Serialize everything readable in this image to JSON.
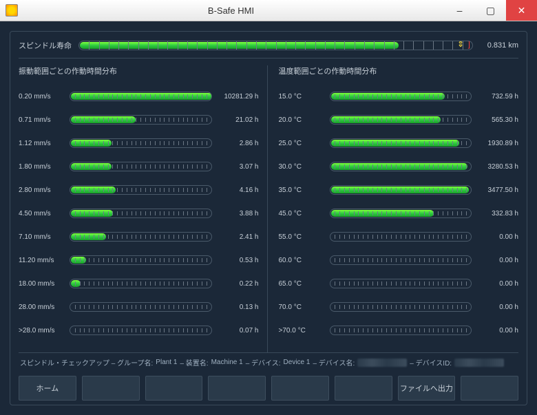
{
  "window": {
    "title": "B-Safe HMI"
  },
  "spindle": {
    "label": "スピンドル寿命",
    "value": "0.831 km",
    "fill_pct": 81
  },
  "left": {
    "title": "振動範囲ごとの作動時間分布",
    "rows": [
      {
        "label": "0.20 mm/s",
        "value": "10281.29 h",
        "pct": 100
      },
      {
        "label": "0.71 mm/s",
        "value": "21.02 h",
        "pct": 46
      },
      {
        "label": "1.12 mm/s",
        "value": "2.86 h",
        "pct": 29
      },
      {
        "label": "1.80 mm/s",
        "value": "3.07 h",
        "pct": 29
      },
      {
        "label": "2.80 mm/s",
        "value": "4.16 h",
        "pct": 32
      },
      {
        "label": "4.50 mm/s",
        "value": "3.88 h",
        "pct": 30
      },
      {
        "label": "7.10 mm/s",
        "value": "2.41 h",
        "pct": 25
      },
      {
        "label": "11.20 mm/s",
        "value": "0.53 h",
        "pct": 11
      },
      {
        "label": "18.00 mm/s",
        "value": "0.22 h",
        "pct": 7
      },
      {
        "label": "28.00 mm/s",
        "value": "0.13 h",
        "pct": 0
      },
      {
        "label": ">28.0 mm/s",
        "value": "0.07 h",
        "pct": 0
      }
    ]
  },
  "right": {
    "title": "温度範囲ごとの作動時間分布",
    "rows": [
      {
        "label": "15.0 °C",
        "value": "732.59 h",
        "pct": 81
      },
      {
        "label": "20.0 °C",
        "value": "565.30 h",
        "pct": 78
      },
      {
        "label": "25.0 °C",
        "value": "1930.89 h",
        "pct": 91
      },
      {
        "label": "30.0 °C",
        "value": "3280.53 h",
        "pct": 97
      },
      {
        "label": "35.0 °C",
        "value": "3477.50 h",
        "pct": 98
      },
      {
        "label": "45.0 °C",
        "value": "332.83 h",
        "pct": 73
      },
      {
        "label": "55.0 °C",
        "value": "0.00 h",
        "pct": 0
      },
      {
        "label": "60.0 °C",
        "value": "0.00 h",
        "pct": 0
      },
      {
        "label": "65.0 °C",
        "value": "0.00 h",
        "pct": 0
      },
      {
        "label": "70.0 °C",
        "value": "0.00 h",
        "pct": 0
      },
      {
        "label": ">70.0 °C",
        "value": "0.00 h",
        "pct": 0
      }
    ]
  },
  "statusbar": {
    "prefix": "スピンドル・チェックアップ – グループ名:",
    "group": "Plant 1",
    "machine_lbl": "– 装置名:",
    "machine": "Machine 1",
    "device_lbl": "– デバイス:",
    "device": "Device 1",
    "devname_lbl": "– デバイス名:",
    "devid_lbl": "– デバイスID:"
  },
  "footer": {
    "home": "ホーム",
    "export": "ファイルへ出力"
  }
}
